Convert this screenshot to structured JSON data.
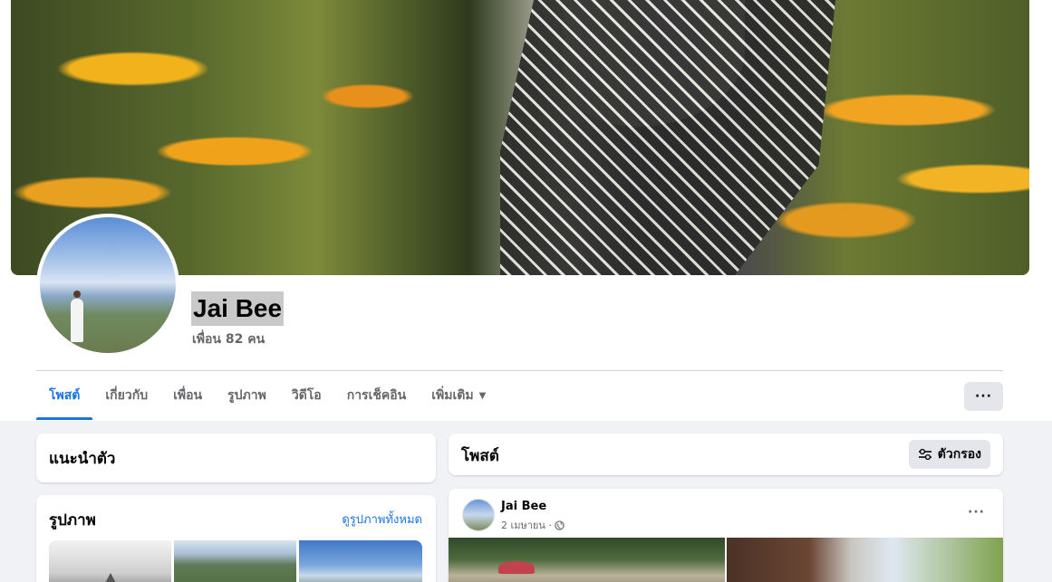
{
  "profile": {
    "name": "Jai Bee",
    "friends_count_text": "เพื่อน 82 คน"
  },
  "tabs": [
    {
      "label": "โพสต์",
      "active": true
    },
    {
      "label": "เกี่ยวกับ",
      "active": false
    },
    {
      "label": "เพื่อน",
      "active": false
    },
    {
      "label": "รูปภาพ",
      "active": false
    },
    {
      "label": "วิดีโอ",
      "active": false
    },
    {
      "label": "การเช็คอิน",
      "active": false
    },
    {
      "label": "เพิ่มเติม",
      "active": false
    }
  ],
  "more_options_label": "···",
  "intro": {
    "title": "แนะนำตัว"
  },
  "photos": {
    "title": "รูปภาพ",
    "see_all_label": "ดูรูปภาพทั้งหมด"
  },
  "posts": {
    "title": "โพสต์",
    "filter_label": "ตัวกรอง"
  },
  "post": {
    "author": "Jai Bee",
    "date": "2 เมษายน ·",
    "options_label": "···",
    "privacy_icon": "globe-icon"
  },
  "colors": {
    "accent": "#1b74e4",
    "background": "#f0f2f5",
    "secondary_text": "#65676b"
  }
}
